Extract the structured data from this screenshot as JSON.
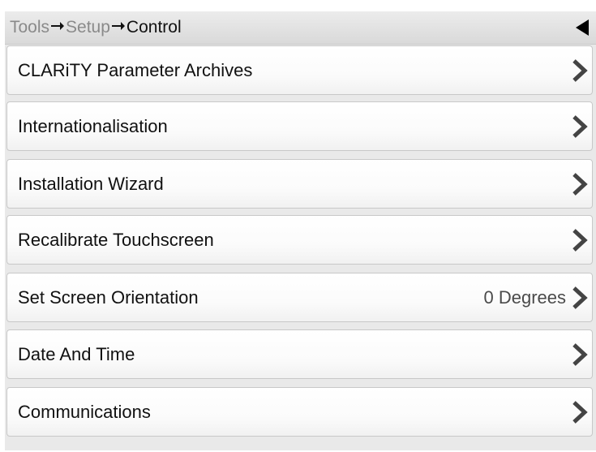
{
  "header": {
    "crumbs": [
      "Tools",
      "Setup"
    ],
    "current": "Control",
    "back_icon": "back-triangle-icon"
  },
  "menu": {
    "items": [
      {
        "label": "CLARiTY Parameter Archives",
        "value": ""
      },
      {
        "label": "Internationalisation",
        "value": ""
      },
      {
        "label": "Installation Wizard",
        "value": ""
      },
      {
        "label": "Recalibrate Touchscreen",
        "value": ""
      },
      {
        "label": "Set Screen Orientation",
        "value": "0 Degrees"
      },
      {
        "label": "Date And Time",
        "value": ""
      },
      {
        "label": "Communications",
        "value": ""
      }
    ],
    "chevron_icon": "chevron-right-icon"
  },
  "colors": {
    "background": "#e9e9e9",
    "item_background": "#ffffff",
    "text": "#111111",
    "crumb_muted": "#8a8a8a",
    "chevron": "#444444"
  }
}
